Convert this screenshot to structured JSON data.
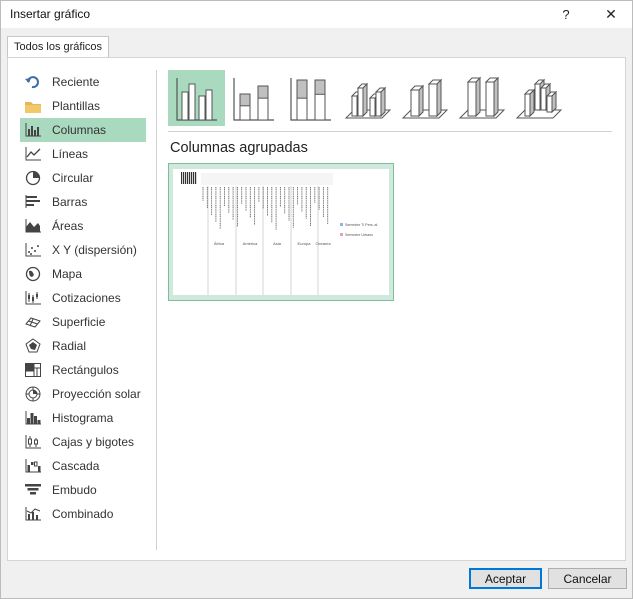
{
  "window": {
    "title": "Insertar gráfico",
    "help_glyph": "?",
    "close_glyph": "✕"
  },
  "tabs": [
    {
      "label": "Todos los gráficos"
    }
  ],
  "nav": {
    "selected_index": 2,
    "items": [
      {
        "label": "Reciente",
        "icon": "undo-icon"
      },
      {
        "label": "Plantillas",
        "icon": "folder-icon"
      },
      {
        "label": "Columnas",
        "icon": "column-chart-icon"
      },
      {
        "label": "Líneas",
        "icon": "line-chart-icon"
      },
      {
        "label": "Circular",
        "icon": "pie-chart-icon"
      },
      {
        "label": "Barras",
        "icon": "bar-chart-icon"
      },
      {
        "label": "Áreas",
        "icon": "area-chart-icon"
      },
      {
        "label": "X Y (dispersión)",
        "icon": "scatter-chart-icon"
      },
      {
        "label": "Mapa",
        "icon": "map-chart-icon"
      },
      {
        "label": "Cotizaciones",
        "icon": "stock-chart-icon"
      },
      {
        "label": "Superficie",
        "icon": "surface-chart-icon"
      },
      {
        "label": "Radial",
        "icon": "radar-chart-icon"
      },
      {
        "label": "Rectángulos",
        "icon": "treemap-chart-icon"
      },
      {
        "label": "Proyección solar",
        "icon": "sunburst-chart-icon"
      },
      {
        "label": "Histograma",
        "icon": "histogram-chart-icon"
      },
      {
        "label": "Cajas y bigotes",
        "icon": "box-whisker-chart-icon"
      },
      {
        "label": "Cascada",
        "icon": "waterfall-chart-icon"
      },
      {
        "label": "Embudo",
        "icon": "funnel-chart-icon"
      },
      {
        "label": "Combinado",
        "icon": "combo-chart-icon"
      }
    ]
  },
  "subtypes": {
    "selected_index": 0,
    "items": [
      "clustered-column-icon",
      "stacked-column-icon",
      "100-stacked-column-icon",
      "3d-clustered-column-icon",
      "3d-stacked-column-icon",
      "3d-100-stacked-column-icon",
      "3d-column-icon"
    ]
  },
  "section_title": "Columnas agrupadas",
  "preview": {
    "categories": [
      "África",
      "América",
      "Asia",
      "Europa",
      "Oceanía"
    ],
    "legend": [
      "Semestre Ti Pers..al",
      "Semestre Urbano"
    ],
    "colors": {
      "series1": "#8eb4e3",
      "series2": "#e6a0c4",
      "bars": "#333333"
    }
  },
  "buttons": {
    "ok": "Aceptar",
    "cancel": "Cancelar"
  },
  "colors": {
    "selected_bg": "#a9d9bf",
    "accent": "#0078d7"
  }
}
